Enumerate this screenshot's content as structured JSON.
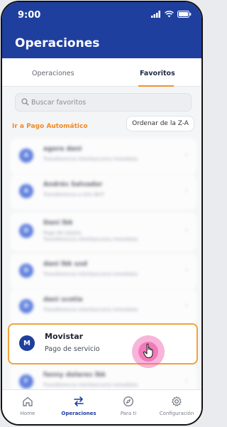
{
  "status_bar": {
    "time": "9:00",
    "icons": [
      "signal-icon",
      "wifi-icon",
      "battery-icon"
    ]
  },
  "header": {
    "title": "Operaciones"
  },
  "tabs": [
    {
      "label": "Operaciones",
      "active": false
    },
    {
      "label": "Favoritos",
      "active": true
    }
  ],
  "search": {
    "placeholder": "Buscar favoritos",
    "value": ""
  },
  "links": {
    "auto_payment": "Ir a Pago Automático"
  },
  "sort": {
    "label": "Ordenar de la Z-A"
  },
  "favorites": [
    {
      "avatar": "A",
      "name": "agora dani",
      "subtitle": "Transferencia interbancaria inmediata",
      "subtitle2": ""
    },
    {
      "avatar": "A",
      "name": "Andrés Salvador",
      "subtitle": "Transferencia a otro BCP",
      "subtitle2": ""
    },
    {
      "avatar": "D",
      "name": "Dani lbk",
      "subtitle": "Pago de tarjeta",
      "subtitle2": "Transferencia interbancaria inmediata"
    },
    {
      "avatar": "D",
      "name": "dani lbk usd",
      "subtitle": "Transferencia interbancaria inmediata",
      "subtitle2": ""
    },
    {
      "avatar": "D",
      "name": "dani scotia",
      "subtitle": "Transferencia interbancaria inmediata",
      "subtitle2": ""
    },
    {
      "avatar": "F",
      "name": "fanny dolares lbk",
      "subtitle": "Transferencia interbancaria inmediata",
      "subtitle2": ""
    }
  ],
  "selected_favorite": {
    "avatar": "M",
    "name": "Movistar",
    "subtitle": "Pago de servicio"
  },
  "bottom_nav": [
    {
      "label": "Home",
      "icon": "home-icon",
      "active": false
    },
    {
      "label": "Operaciones",
      "icon": "transfer-icon",
      "active": true
    },
    {
      "label": "Para ti",
      "icon": "compass-icon",
      "active": false
    },
    {
      "label": "Configuración",
      "icon": "gear-icon",
      "active": false
    }
  ],
  "colors": {
    "primary": "#1f3f9e",
    "accent": "#f0932b",
    "tap_highlight": "#ec48a0"
  }
}
